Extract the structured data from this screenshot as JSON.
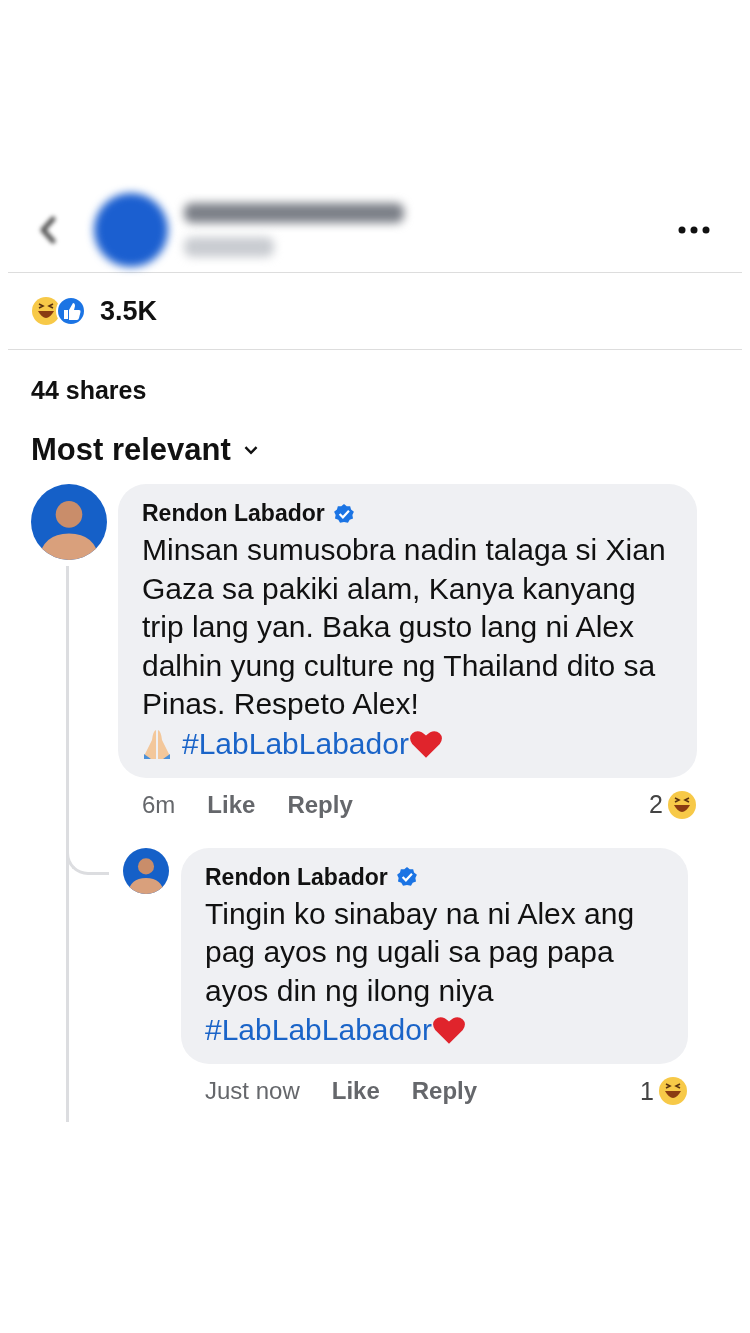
{
  "post": {
    "reaction_count": "3.5K",
    "shares": "44 shares",
    "sort": "Most relevant"
  },
  "comments": [
    {
      "author": "Rendon Labador",
      "verified": true,
      "text": "Minsan sumusobra nadin talaga si Xian Gaza sa pakiki alam, Kanya kanyang trip lang yan. Baka gusto lang ni Alex dalhin yung culture ng Thailand dito sa Pinas. Respeto Alex!",
      "prayer_emoji": true,
      "hashtag": "#LabLabLabador",
      "time": "6m",
      "like": "Like",
      "reply": "Reply",
      "reaction_count": "2",
      "replies": [
        {
          "author": "Rendon Labador",
          "verified": true,
          "text": "Tingin ko sinabay na ni Alex ang pag ayos ng ugali sa pag papa ayos din ng ilong niya",
          "hashtag": "#LabLabLabador",
          "time": "Just now",
          "like": "Like",
          "reply": "Reply",
          "reaction_count": "1"
        }
      ]
    }
  ]
}
